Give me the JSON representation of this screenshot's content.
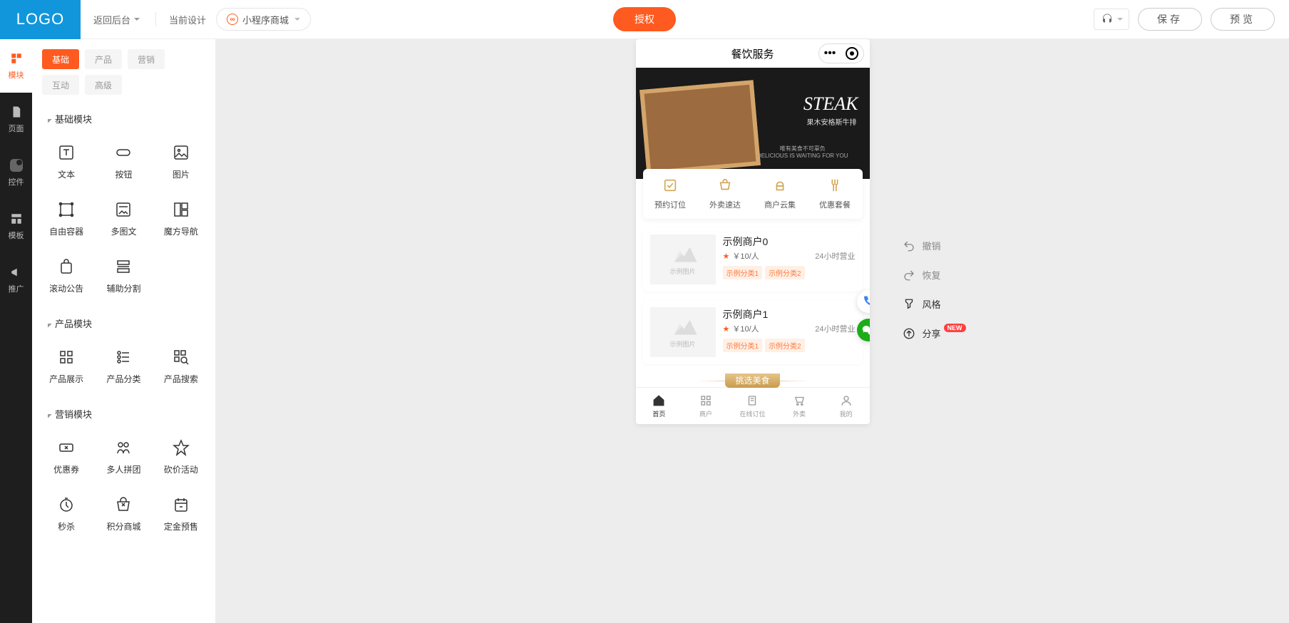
{
  "header": {
    "logo": "LOGO",
    "back": "返回后台",
    "design_label": "当前设计",
    "project_name": "小程序商城",
    "auth_btn": "授权",
    "save_btn": "保存",
    "preview_btn": "预览"
  },
  "rail": {
    "items": [
      "模块",
      "页面",
      "控件",
      "模板",
      "推广"
    ]
  },
  "panel": {
    "cats": [
      "基础",
      "产品",
      "营销",
      "互动",
      "高级"
    ],
    "sections": {
      "basic_title": "基础模块",
      "product_title": "产品模块",
      "marketing_title": "营销模块",
      "basic": [
        "文本",
        "按钮",
        "图片",
        "自由容器",
        "多图文",
        "魔方导航",
        "滚动公告",
        "辅助分割"
      ],
      "product": [
        "产品展示",
        "产品分类",
        "产品搜索"
      ],
      "marketing": [
        "优惠券",
        "多人拼团",
        "砍价活动",
        "秒杀",
        "积分商城",
        "定金预售"
      ]
    }
  },
  "phone": {
    "title": "餐饮服务",
    "banner": {
      "title": "STEAK",
      "sub": "果木安格斯牛排",
      "small1": "唯有美食不可辜负",
      "small2": "DELICIOUS IS WAITING FOR YOU"
    },
    "nav": [
      "预约订位",
      "外卖速达",
      "商户云集",
      "优惠套餐"
    ],
    "stores": [
      {
        "name": "示例商户0",
        "price": "￥10/人",
        "hours": "24小时营业",
        "tags": [
          "示例分类1",
          "示例分类2"
        ],
        "img_label": "示例图片"
      },
      {
        "name": "示例商户1",
        "price": "￥10/人",
        "hours": "24小时营业",
        "tags": [
          "示例分类1",
          "示例分类2"
        ],
        "img_label": "示例图片"
      }
    ],
    "pick_title": "挑选美食",
    "tabs": [
      "首页",
      "商户",
      "在线订位",
      "外卖",
      "我的"
    ]
  },
  "right_actions": {
    "undo": "撤销",
    "redo": "恢复",
    "style": "风格",
    "share": "分享",
    "share_badge": "NEW"
  }
}
